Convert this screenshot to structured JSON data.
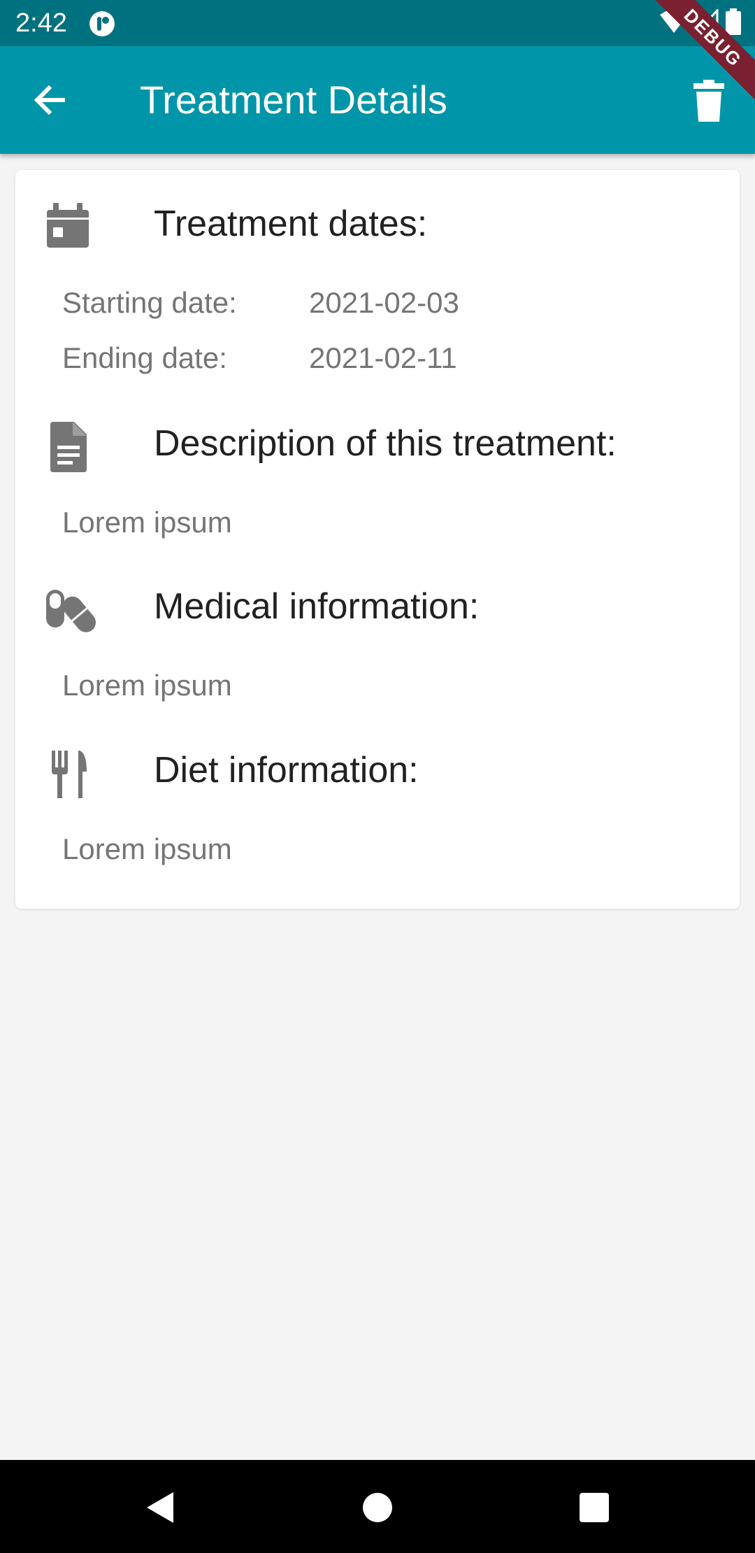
{
  "status_bar": {
    "time": "2:42",
    "debug_label": "DEBUG"
  },
  "app_bar": {
    "title": "Treatment Details"
  },
  "sections": {
    "dates": {
      "heading": "Treatment dates:",
      "start_label": "Starting date:",
      "start_value": "2021-02-03",
      "end_label": "Ending date:",
      "end_value": "2021-02-11"
    },
    "description": {
      "heading": "Description of this treatment:",
      "text": "Lorem ipsum"
    },
    "medical": {
      "heading": "Medical information:",
      "text": "Lorem ipsum"
    },
    "diet": {
      "heading": "Diet information:",
      "text": "Lorem ipsum"
    }
  },
  "colors": {
    "status_bar": "#00717f",
    "app_bar": "#0095a8",
    "icon_gray": "#757575",
    "background": "#f4f4f4"
  },
  "icons": [
    "back-arrow-icon",
    "delete-icon",
    "calendar-icon",
    "document-icon",
    "pills-icon",
    "fork-knife-icon"
  ]
}
